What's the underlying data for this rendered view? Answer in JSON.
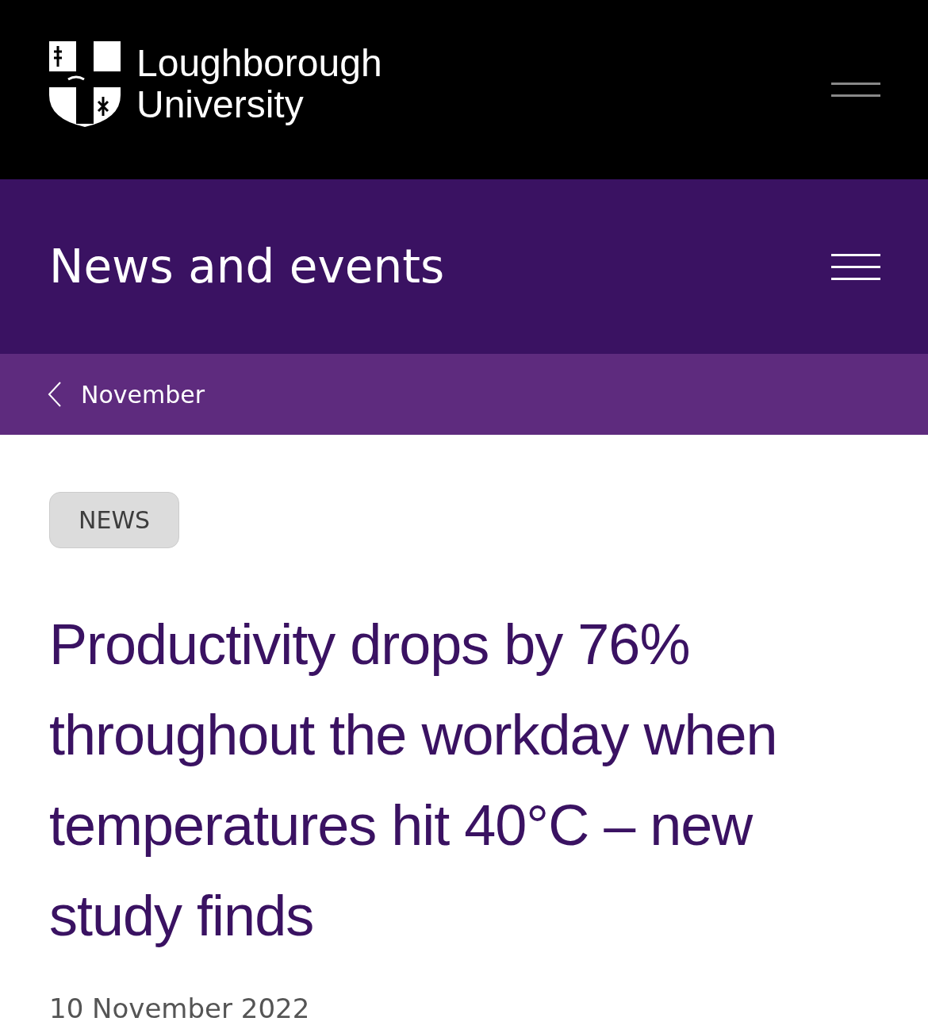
{
  "header": {
    "brand_lines": [
      "Loughborough",
      "University"
    ]
  },
  "section": {
    "title": "News and events"
  },
  "breadcrumb": {
    "label": "November"
  },
  "article": {
    "tag": "NEWS",
    "title": "Productivity drops by 76% throughout the workday when temperatures hit 40°C – new study finds",
    "date": "10 November 2022"
  }
}
